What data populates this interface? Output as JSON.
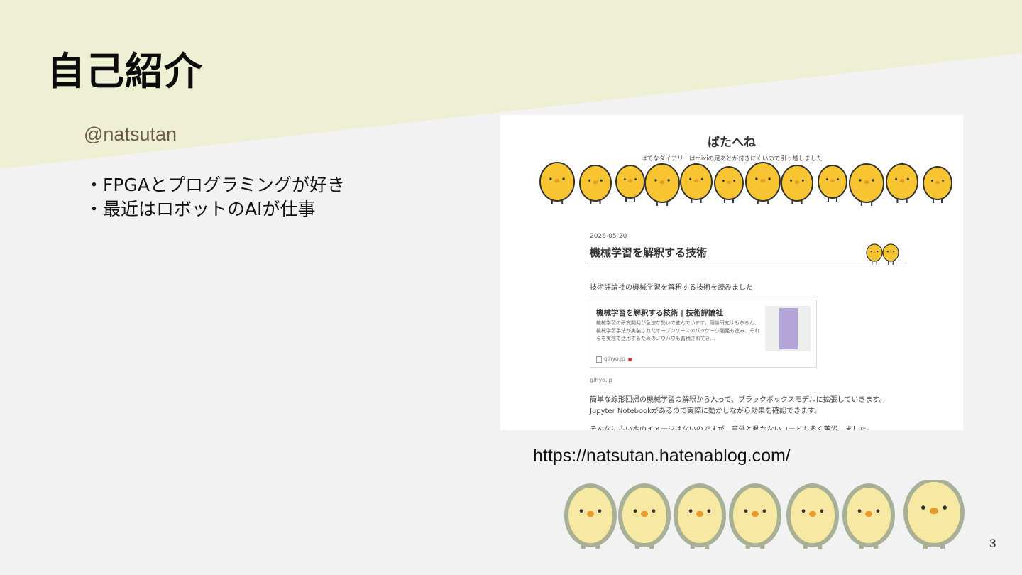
{
  "slide": {
    "title": "自己紹介",
    "handle": "@natsutan",
    "bullets": [
      "FPGAとプログラミングが好き",
      "最近はロボットのAIが仕事"
    ],
    "url": "https://natsutan.hatenablog.com/",
    "page_number": "3"
  },
  "blog": {
    "title": "ばたへね",
    "subtitle": "はてなダイアリーはmixiの足あとが付きにくいので引っ越しました",
    "post": {
      "date": "2026-05-20",
      "title": "機械学習を解釈する技術",
      "intro": "技術評論社の機械学習を解釈する技術を読みました",
      "embed": {
        "title": "機械学習を解釈する技術 | 技術評論社",
        "description": "機械学習の研究開発が急速な勢いで進んでいます。理論研究はもちろん、機械学習手法が実装されたオープンソースのパッケージ開発も進み、それらを実務で活用するためのノウハウも蓄積されてき...",
        "source": "gihyo.jp"
      },
      "source_link": "gihyo.jp",
      "paragraphs": [
        "簡単な線形回帰の機械学習の解釈から入って、ブラックボックスモデルに拡張していきます。",
        "Jupyter Notebookがあるので実際に動かしながら効果を確認できます。",
        "そんなに古い本のイメージはないのですが、意外と動かないコードも多く苦労しました。"
      ]
    }
  },
  "colors": {
    "band": "#eef0d4",
    "background": "#f2f2f2",
    "chick_yellow": "#f7c531",
    "chick_pale": "#f8e9a2",
    "chick_outline": "#a9b098"
  }
}
